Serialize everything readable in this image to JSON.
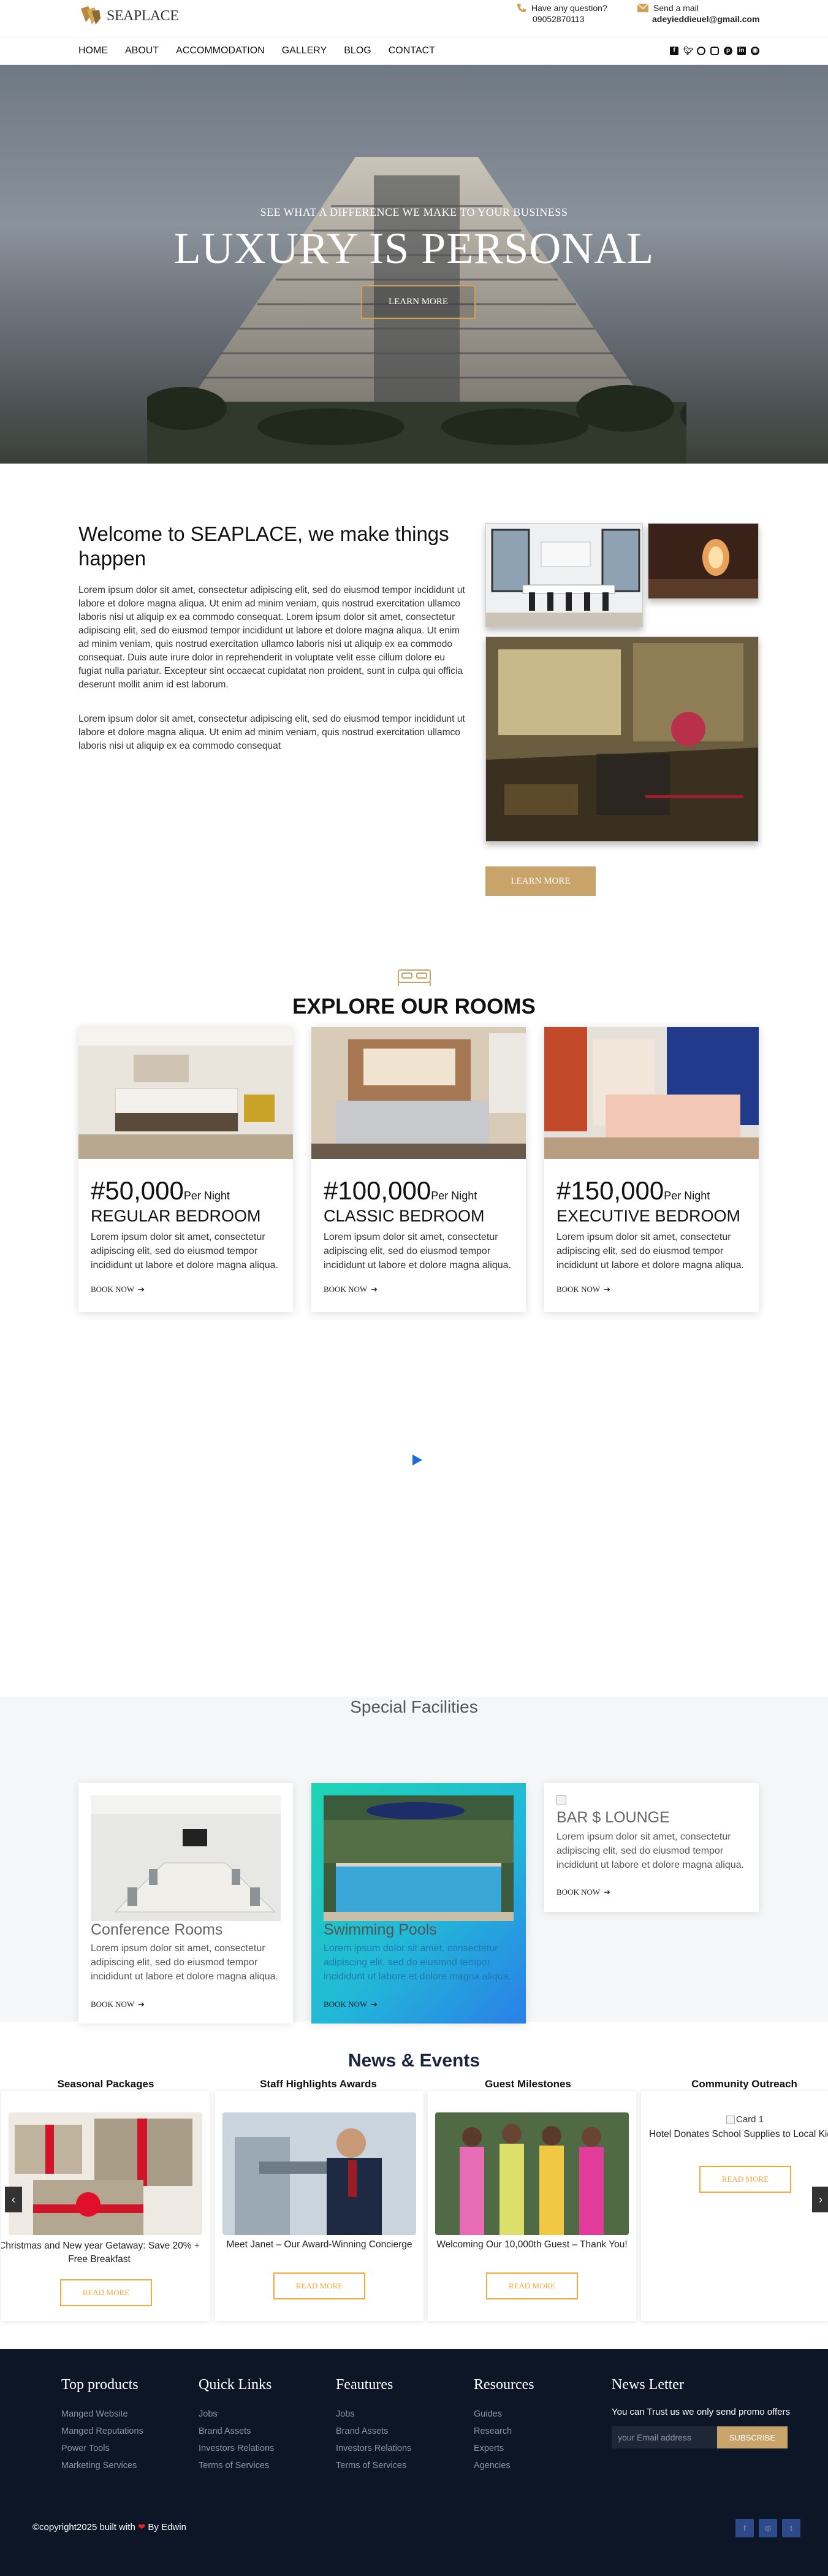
{
  "header": {
    "logo_text": "SEAPLACE",
    "phone_label": "Have any question?",
    "phone_value": "09052870113",
    "mail_label": "Send a mail",
    "mail_value": "adeyieddieuel@gmail.com"
  },
  "nav": {
    "items": [
      "HOME",
      "ABOUT",
      "ACCOMMODATION",
      "GALLERY",
      "BLOG",
      "CONTACT"
    ],
    "social_icons": [
      "facebook-icon",
      "twitter-icon",
      "whatsapp-icon",
      "instagram-icon",
      "pinterest-icon",
      "linkedin-icon",
      "github-icon"
    ]
  },
  "hero": {
    "tagline": "SEE WHAT A DIFFERENCE WE MAKE TO YOUR BUSINESS",
    "title": "LUXURY IS PERSONAL",
    "button": "LEARN MORE"
  },
  "welcome": {
    "title": "Welcome to SEAPLACE, we make things happen",
    "p1": "Lorem ipsum dolor sit amet, consectetur adipiscing elit, sed do eiusmod tempor incididunt ut labore et dolore magna aliqua. Ut enim ad minim veniam, quis nostrud exercitation ullamco laboris nisi ut aliquip ex ea commodo consequat. Lorem ipsum dolor sit amet, consectetur adipiscing elit, sed do eiusmod tempor incididunt ut labore et dolore magna aliqua. Ut enim ad minim veniam, quis nostrud exercitation ullamco laboris nisi ut aliquip ex ea commodo consequat. Duis aute irure dolor in reprehenderit in voluptate velit esse cillum dolore eu fugiat nulla pariatur. Excepteur sint occaecat cupidatat non proident, sunt in culpa qui officia deserunt mollit anim id est laborum.",
    "p2": "Lorem ipsum dolor sit amet, consectetur adipiscing elit, sed do eiusmod tempor incididunt ut labore et dolore magna aliqua. Ut enim ad minim veniam, quis nostrud exercitation ullamco laboris nisi ut aliquip ex ea commodo consequat",
    "button": "LEARN MORE"
  },
  "rooms": {
    "title": "EXPLORE OUR ROOMS",
    "per_night": "Per Night",
    "book_label": "BOOK NOW",
    "items": [
      {
        "price": "#50,000",
        "name": "REGULAR BEDROOM",
        "desc": "Lorem ipsum dolor sit amet, consectetur adipiscing elit, sed do eiusmod tempor incididunt ut labore et dolore magna aliqua."
      },
      {
        "price": "#100,000",
        "name": "CLASSIC BEDROOM",
        "desc": "Lorem ipsum dolor sit amet, consectetur adipiscing elit, sed do eiusmod tempor incididunt ut labore et dolore magna aliqua."
      },
      {
        "price": "#150,000",
        "name": "EXECUTIVE BEDROOM",
        "desc": "Lorem ipsum dolor sit amet, consectetur adipiscing elit, sed do eiusmod tempor incididunt ut labore et dolore magna aliqua."
      }
    ]
  },
  "facilities": {
    "title": "Special Facilities",
    "book_label": "BOOK NOW",
    "items": [
      {
        "name": "Conference Rooms",
        "desc": "Lorem ipsum dolor sit amet, consectetur adipiscing elit, sed do eiusmod tempor incididunt ut labore et dolore magna aliqua."
      },
      {
        "name": "Swimming Pools",
        "desc": "Lorem ipsum dolor sit amet, consectetur adipiscing elit, sed do eiusmod tempor incididunt ut labore et dolore magna aliqua."
      },
      {
        "name": "BAR $ LOUNGE",
        "desc": "Lorem ipsum dolor sit amet, consectetur adipiscing elit, sed do eiusmod tempor incididunt ut labore et dolore magna aliqua."
      }
    ]
  },
  "news": {
    "title": "News & Events",
    "read_more": "READ MORE",
    "items": [
      {
        "category": "Seasonal Packages",
        "text": "Christmas and New year Getaway: Save 20% + Free Breakfast"
      },
      {
        "category": "Staff Highlights Awards",
        "text": "Meet Janet – Our Award-Winning Concierge"
      },
      {
        "category": "Guest Milestones",
        "text": "Welcoming Our 10,000th Guest – Thank You!"
      },
      {
        "category": "Community Outreach",
        "img_alt": "Card 1",
        "text": "Hotel Donates School Supplies to Local Kids"
      }
    ]
  },
  "footer": {
    "top_products": {
      "title": "Top products",
      "items": [
        "Manged Website",
        "Manged Reputations",
        "Power Tools",
        "Marketing Services"
      ]
    },
    "quick_links": {
      "title": "Quick Links",
      "items": [
        "Jobs",
        "Brand Assets",
        "Investors Relations",
        "Terms of Services"
      ]
    },
    "features": {
      "title": "Feautures",
      "items": [
        "Jobs",
        "Brand Assets",
        "Investors Relations",
        "Terms of Services"
      ]
    },
    "resources": {
      "title": "Resources",
      "items": [
        "Guides",
        "Research",
        "Experts",
        "Agencies"
      ]
    },
    "newsletter": {
      "title": "News Letter",
      "text": "You can Trust us we only send promo offers",
      "placeholder": "your Email address",
      "button": "SUBSCRIBE"
    },
    "copyright_pre": "©copyright2025 built with",
    "copyright_post": "By Edwin",
    "social_icons": [
      "facebook-icon",
      "instagram-icon",
      "twitter-icon"
    ]
  }
}
